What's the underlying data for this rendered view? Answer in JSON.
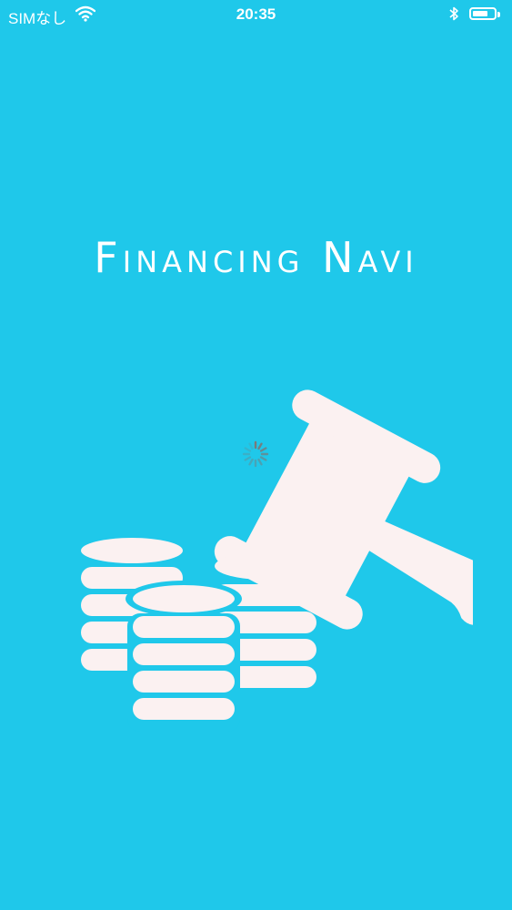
{
  "status_bar": {
    "carrier": "SIMなし",
    "time": "20:35",
    "wifi_icon": "wifi-icon",
    "bluetooth_icon": "bluetooth-icon",
    "battery_icon": "battery-icon"
  },
  "splash": {
    "title": "Financing Navi",
    "logo_icon": "gavel-and-coins-icon",
    "loading_icon": "loading-spinner-icon"
  },
  "colors": {
    "background": "#1fc8ea",
    "foreground": "#ffffff",
    "logo_fill": "#fbf1f1"
  }
}
